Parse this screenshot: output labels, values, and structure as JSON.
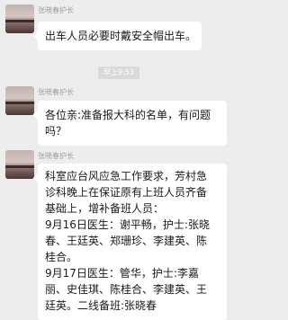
{
  "messages": [
    {
      "sender": "张晓春护长",
      "avatar_icon": "sunset-landscape-avatar",
      "lines": [
        "出车人员必要时戴安全帽出车。"
      ]
    },
    {
      "sender": "张晓春护长",
      "avatar_icon": "sunset-landscape-avatar",
      "lines": [
        "各位亲:准备报大科的名单，有问题",
        "吗？"
      ]
    },
    {
      "sender": "张晓春护长",
      "avatar_icon": "sunset-landscape-avatar",
      "lines": [
        "科室应台风应急工作要求，芳村急",
        "诊科晚上在保证原有上班人员齐备",
        "基础上，增补备班人员：",
        "9月16日医生：谢平畅，护士:张晓",
        "春、王廷英、郑珊珍、李建英、陈",
        "桂合。",
        "9月17日医生：管华，护士:李嘉",
        "丽、史佳琪、陈桂合、李建英、王",
        "廷英。二线备班:张晓春"
      ]
    }
  ],
  "timestamp": "早上9:53",
  "colors": {
    "background": "#ededed",
    "bubble": "#ffffff",
    "sender_text": "#a0a0a0",
    "time_badge": "#dadada"
  }
}
